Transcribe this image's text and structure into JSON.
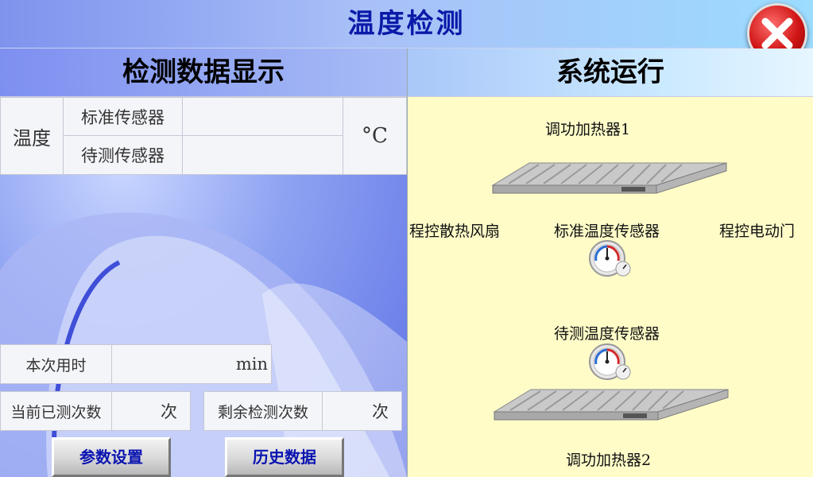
{
  "window": {
    "title": "温度检测"
  },
  "left_panel": {
    "header": "检测数据显示",
    "temperature": {
      "row_label": "温度",
      "standard_sensor_label": "标准传感器",
      "standard_sensor_value": "",
      "test_sensor_label": "待测传感器",
      "test_sensor_value": "",
      "unit": "°C"
    },
    "elapsed": {
      "label": "本次用时",
      "value": "",
      "unit": "min"
    },
    "tested_count": {
      "label": "当前已测次数",
      "value": "",
      "unit": "次"
    },
    "remaining_count": {
      "label": "剩余检测次数",
      "value": "",
      "unit": "次"
    },
    "buttons": {
      "settings": "参数设置",
      "history": "历史数据"
    }
  },
  "right_panel": {
    "header": "系统运行",
    "heater1_label": "调功加热器1",
    "fan_label": "程控散热风扇",
    "standard_sensor_label": "标准温度传感器",
    "door_label": "程控电动门",
    "test_sensor_label": "待测温度传感器",
    "heater2_label": "调功加热器2"
  },
  "colors": {
    "title_text": "#0a1aa8",
    "button_text": "#0a14b0",
    "right_panel_bg": "#fffcc8"
  },
  "icons": [
    "close-icon",
    "heater-plate-icon",
    "thermometer-gauge-icon"
  ]
}
